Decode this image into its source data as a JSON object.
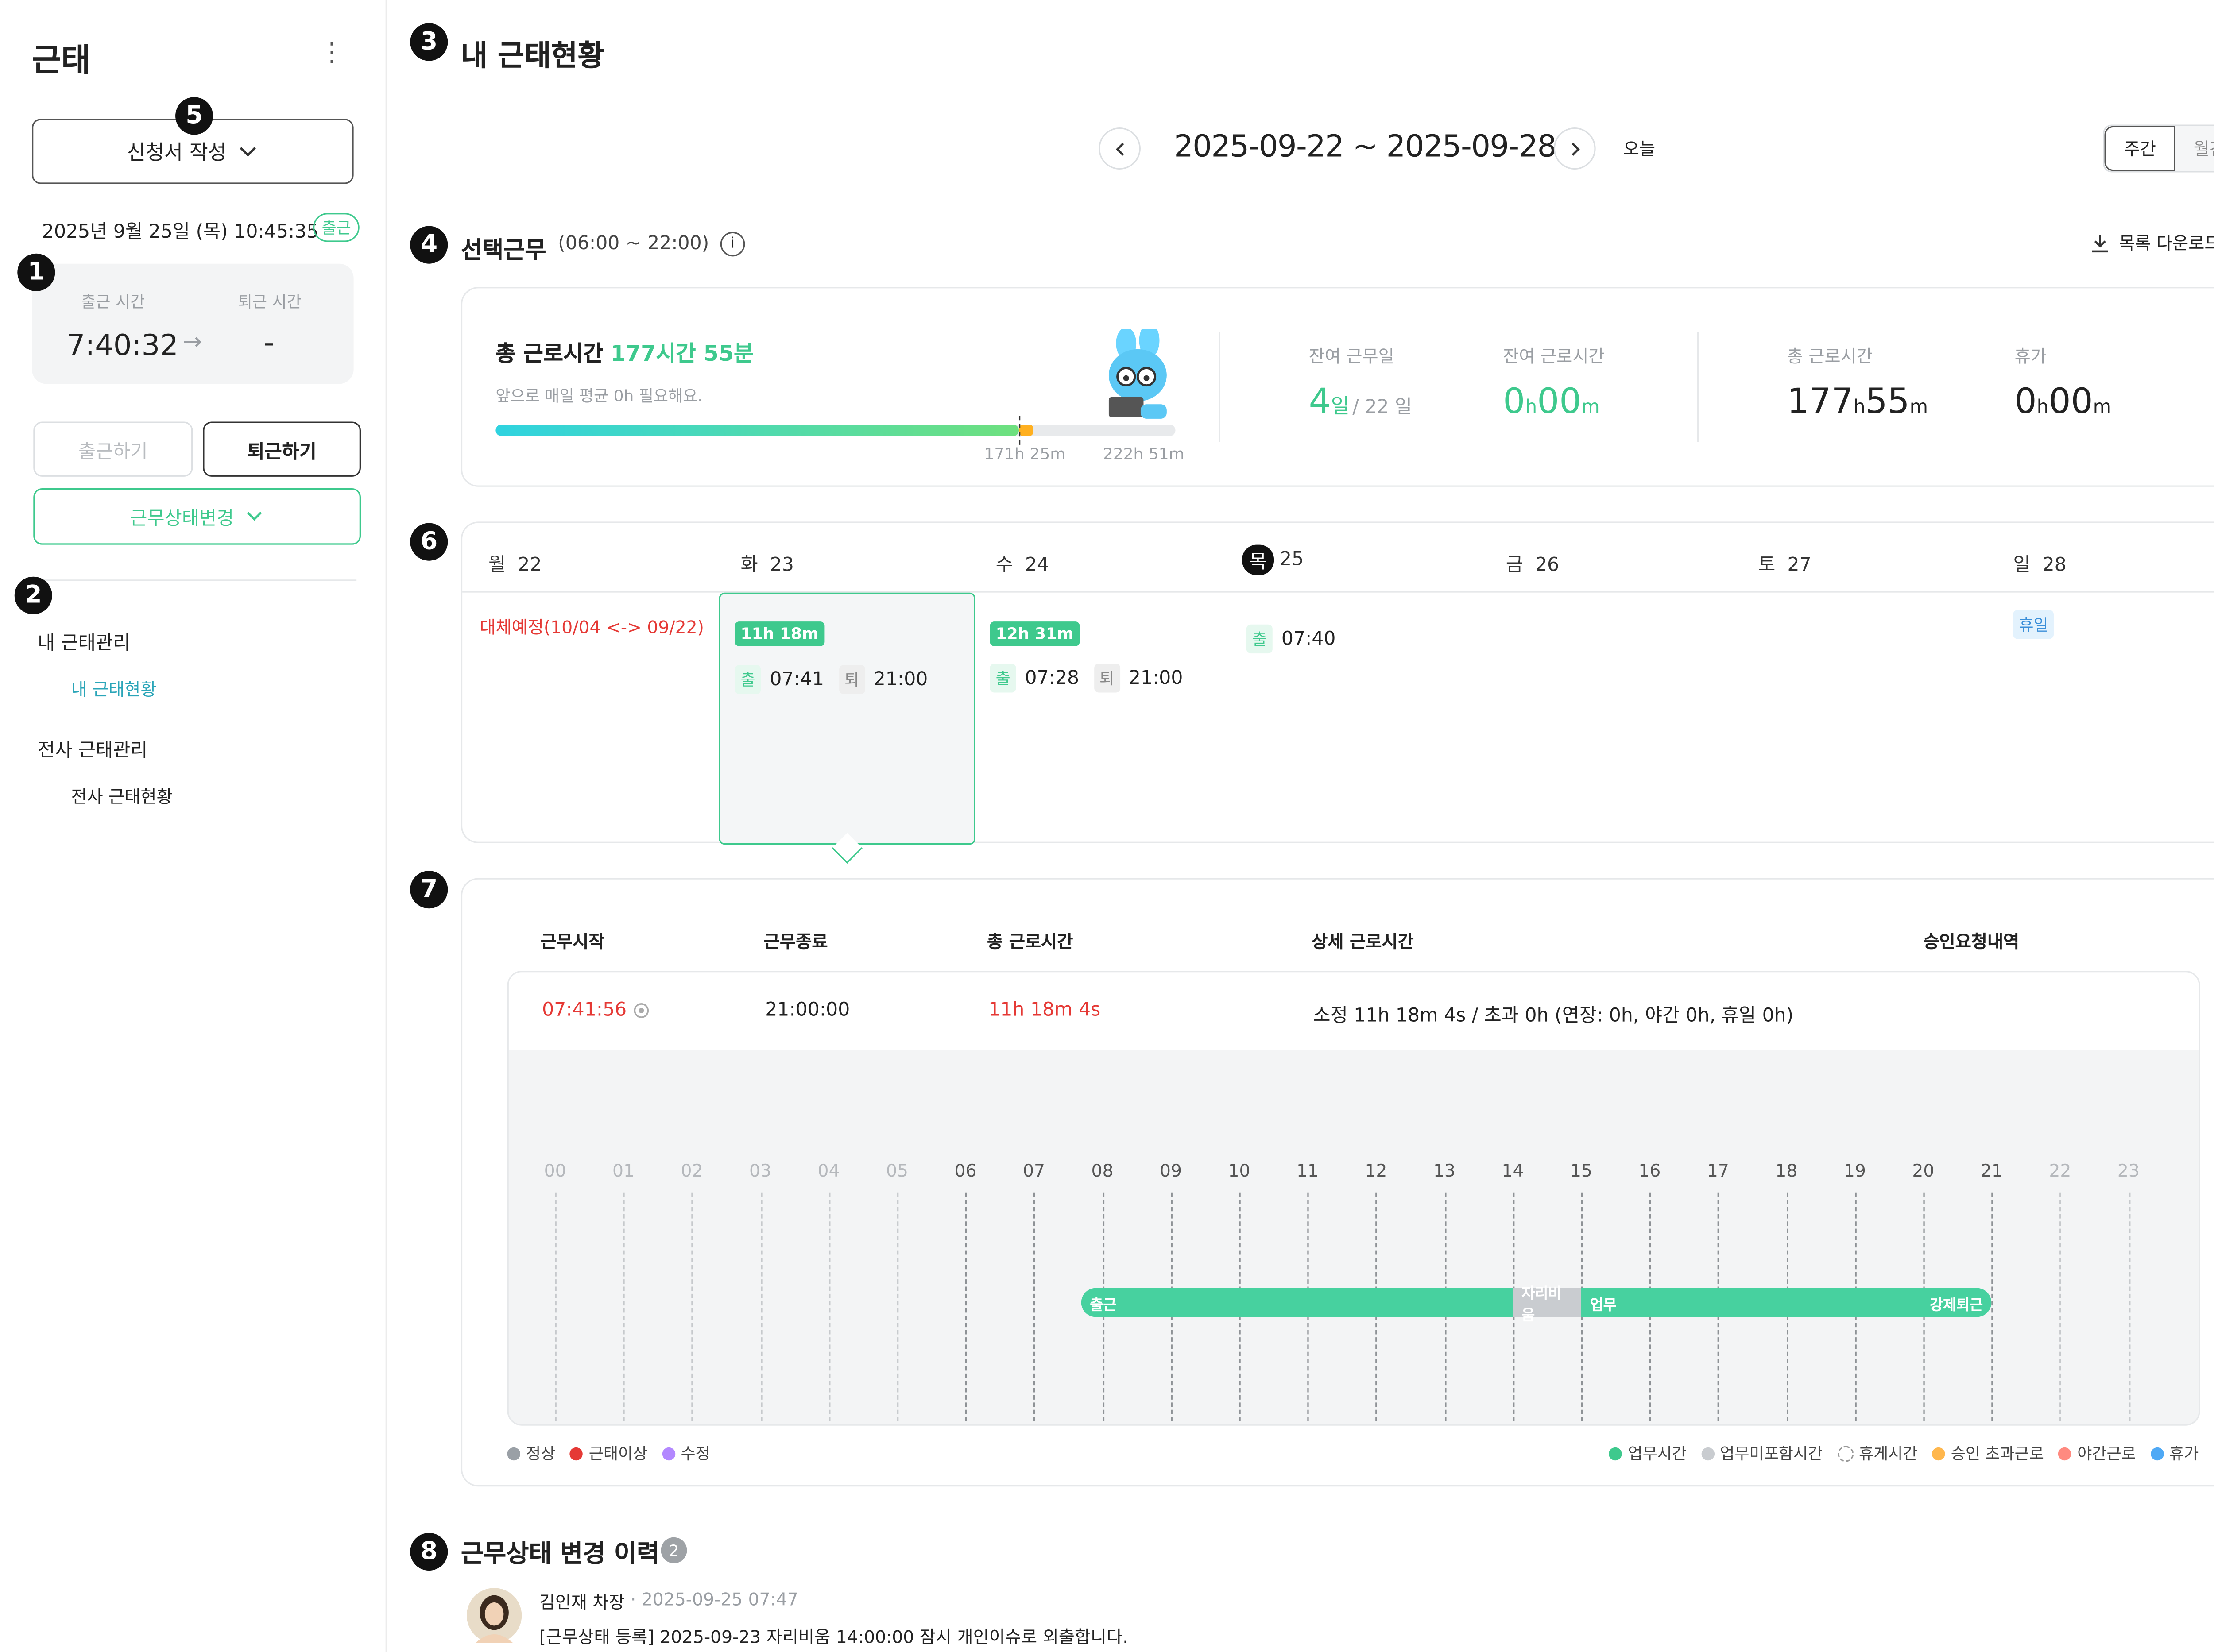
{
  "sidebar": {
    "title": "근태",
    "request_button": "신청서 작성",
    "datetime": "2025년 9월 25일 (목) 10:45:35",
    "status_badge": "출근",
    "checkin_label": "출근 시간",
    "checkout_label": "퇴근 시간",
    "checkin_value": "7:40:32",
    "checkout_value": "-",
    "checkin_button": "출근하기",
    "checkout_button": "퇴근하기",
    "status_change_button": "근무상태변경",
    "menu": [
      {
        "group": "내 근태관리",
        "item": "내 근태현황"
      },
      {
        "group": "전사 근태관리",
        "item": "전사 근태현황"
      }
    ]
  },
  "markers": [
    "1",
    "2",
    "3",
    "4",
    "5",
    "6",
    "7",
    "8"
  ],
  "header": {
    "title": "내 근태현황",
    "date_range": "2025-09-22 ~ 2025-09-28",
    "today": "오늘",
    "view_week": "주간",
    "view_month": "월간"
  },
  "work_type": {
    "title": "선택근무",
    "hours": "(06:00 ~ 22:00)",
    "download": "목록 다운로드"
  },
  "summary": {
    "total_label": "총 근로시간",
    "total_value": "177시간 55분",
    "hint": "앞으로 매일 평균 0h 필요해요.",
    "progress_fraction": 0.77,
    "bar_mark1": "171h 25m",
    "bar_mark2": "222h 51m",
    "stats": [
      {
        "label": "잔여 근무일",
        "value": "4",
        "unit": "일",
        "extra": "/ 22 일"
      },
      {
        "label": "잔여 근로시간",
        "h": "0",
        "hu": "h",
        "m": "00",
        "mu": "m"
      },
      {
        "label": "총 근로시간",
        "h": "177",
        "hu": "h",
        "m": "55",
        "mu": "m"
      },
      {
        "label": "휴가",
        "h": "0",
        "hu": "h",
        "m": "00",
        "mu": "m"
      }
    ]
  },
  "week": {
    "days": [
      {
        "dow": "월",
        "date": "22"
      },
      {
        "dow": "화",
        "date": "23"
      },
      {
        "dow": "수",
        "date": "24"
      },
      {
        "dow": "목",
        "date": "25"
      },
      {
        "dow": "금",
        "date": "26"
      },
      {
        "dow": "토",
        "date": "27"
      },
      {
        "dow": "일",
        "date": "28"
      }
    ],
    "mon_note": "대체예정(10/04 <-> 09/22)",
    "tue": {
      "total": "11h 18m",
      "in_label": "출",
      "in": "07:41",
      "out_label": "퇴",
      "out": "21:00"
    },
    "wed": {
      "total": "12h 31m",
      "in_label": "출",
      "in": "07:28",
      "out_label": "퇴",
      "out": "21:00"
    },
    "thu": {
      "in_label": "출",
      "in": "07:40"
    },
    "sun_badge": "휴일"
  },
  "detail": {
    "headers": {
      "start": "근무시작",
      "end": "근무종료",
      "total": "총 근로시간",
      "breakdown": "상세 근로시간",
      "approval": "승인요청내역"
    },
    "row": {
      "start": "07:41:56",
      "end": "21:00:00",
      "total": "11h 18m 4s",
      "breakdown": "소정 11h 18m 4s / 초과 0h (연장: 0h, 야간 0h, 휴일 0h)"
    },
    "hours": [
      "00",
      "01",
      "02",
      "03",
      "04",
      "05",
      "06",
      "07",
      "08",
      "09",
      "10",
      "11",
      "12",
      "13",
      "14",
      "15",
      "16",
      "17",
      "18",
      "19",
      "20",
      "21",
      "22",
      "23"
    ],
    "bar": {
      "start_label": "출근",
      "away_label": "자리비움",
      "work_label": "업무",
      "end_label": "강제퇴근",
      "start_hour": 7.69,
      "away_start": 14.0,
      "away_end": 15.0,
      "end_hour": 21.0
    },
    "legend_left": [
      {
        "label": "정상",
        "color": "#9aa0a6"
      },
      {
        "label": "근태이상",
        "color": "#e53935"
      },
      {
        "label": "수정",
        "color": "#b388ff"
      }
    ],
    "legend_right": [
      {
        "label": "업무시간",
        "color": "#3ec98d"
      },
      {
        "label": "업무미포함시간",
        "color": "#c9ccd0"
      },
      {
        "label": "휴게시간",
        "color": "#ffffff"
      },
      {
        "label": "승인 초과근로",
        "color": "#ffb74d"
      },
      {
        "label": "야간근로",
        "color": "#ff8a80"
      },
      {
        "label": "휴가",
        "color": "#4fa9f5"
      }
    ]
  },
  "history": {
    "title": "근무상태 변경 이력",
    "count": "2",
    "author": "김인재 차장",
    "timestamp": "· 2025-09-25 07:47",
    "message": "[근무상태 등록] 2025-09-23 자리비움 14:00:00 잠시 개인이슈로 외출합니다."
  }
}
